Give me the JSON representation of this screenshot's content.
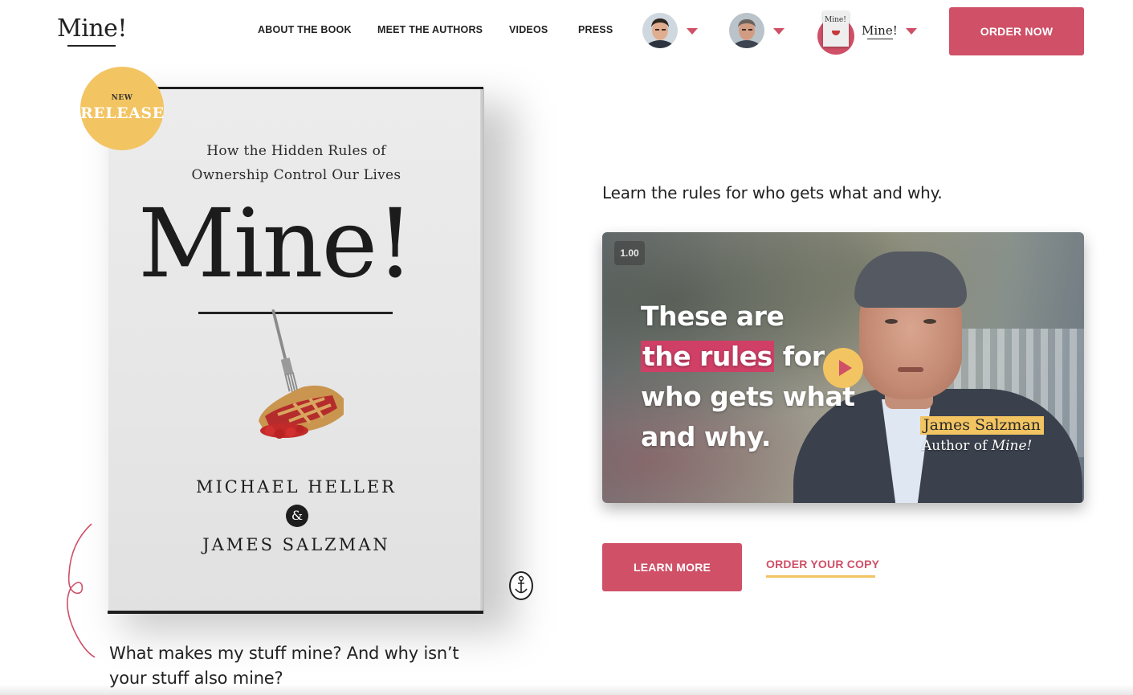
{
  "header": {
    "logo": "Mine!",
    "nav": [
      {
        "label": "ABOUT THE BOOK"
      },
      {
        "label": "MEET THE AUTHORS"
      },
      {
        "label": "VIDEOS"
      },
      {
        "label": "PRESS"
      }
    ],
    "book_switcher_label": "Mine!",
    "order_now": "ORDER NOW"
  },
  "badge": {
    "top": "NEW",
    "bottom": "RELEASE"
  },
  "book": {
    "subtitle_line1": "How the Hidden Rules of",
    "subtitle_line2": "Ownership Control Our Lives",
    "title": "Mine!",
    "author1": "MICHAEL HELLER",
    "ampersand": "&",
    "author2": "JAMES SALZMAN",
    "thumb_title": "Mine!"
  },
  "tagline": {
    "question": "What makes my stuff mine? And why isn’t your stuff also mine?"
  },
  "hero": {
    "lead": "Learn the rules for who gets what and why."
  },
  "video": {
    "speed": "1.00",
    "headline_1": "These are",
    "headline_highlight": "the rules",
    "headline_2": " for",
    "headline_3": "who gets what",
    "headline_4": "and why.",
    "name": "James Salzman",
    "role_prefix": "Author of ",
    "role_book": "Mine!"
  },
  "cta": {
    "learn_more": "LEARN MORE",
    "order_copy": "ORDER YOUR COPY"
  },
  "colors": {
    "accent": "#cf5067",
    "badge": "#f2c462",
    "text": "#222222"
  }
}
